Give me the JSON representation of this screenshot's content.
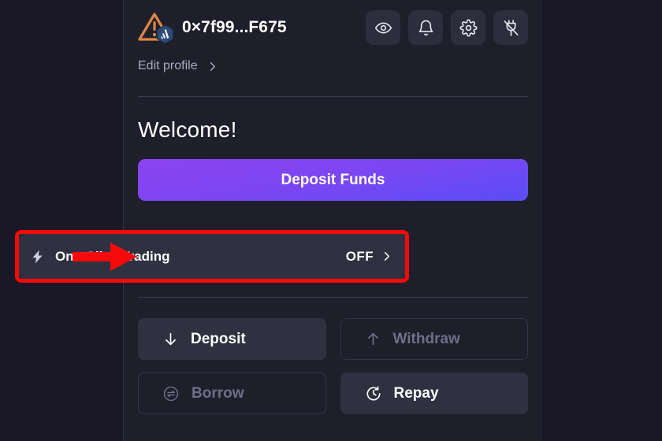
{
  "theme": {
    "page_background": "#1a1726",
    "panel_background": "#1e1f2b",
    "accent_gradient_start": "#8b43f0",
    "accent_gradient_end": "#5a4df5",
    "annotation_red": "#f60a0a",
    "active_button_bg": "#2f3141",
    "disabled_text": "#6d7088"
  },
  "header": {
    "wallet_address": "0×7f99...F675",
    "avatar_icon": "warning-triangle-icon",
    "chain_badge_icon": "arbitrum-chain-icon",
    "actions": [
      {
        "id": "visibility",
        "icon": "eye-icon",
        "title": "Toggle balance visibility"
      },
      {
        "id": "notifications",
        "icon": "bell-icon",
        "title": "Notifications"
      },
      {
        "id": "settings",
        "icon": "gear-icon",
        "title": "Settings"
      },
      {
        "id": "disconnect",
        "icon": "plug-disconnect-icon",
        "title": "Disconnect wallet"
      }
    ]
  },
  "edit_profile": {
    "label": "Edit profile",
    "chevron_icon": "chevron-right-icon"
  },
  "main": {
    "welcome_title": "Welcome!",
    "deposit_funds_label": "Deposit Funds"
  },
  "one_click_trading": {
    "icon": "lightning-bolt-icon",
    "label": "One-Click Trading",
    "state": "OFF",
    "chevron_icon": "chevron-right-icon",
    "highlighted": true
  },
  "actions": [
    {
      "label": "Deposit",
      "icon": "arrow-down-icon",
      "enabled": true
    },
    {
      "label": "Withdraw",
      "icon": "arrow-up-icon",
      "enabled": false
    },
    {
      "label": "Borrow",
      "icon": "swap-circle-icon",
      "enabled": false
    },
    {
      "label": "Repay",
      "icon": "clock-rotate-right-icon",
      "enabled": true
    }
  ],
  "annotations": {
    "arrow_icon": "red-arrow-right-icon",
    "arrow_points_to": "one-click-trading-row"
  }
}
